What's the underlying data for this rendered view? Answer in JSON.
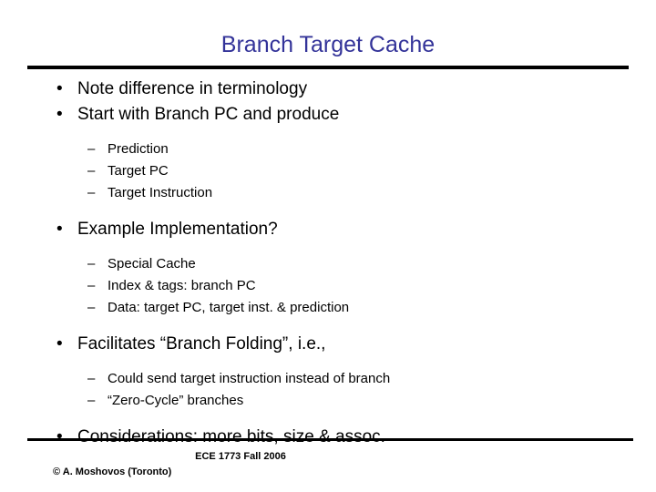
{
  "slide": {
    "title": "Branch Target Cache",
    "title_color": "#333399",
    "background_color": "#ffffff",
    "rule_color": "#000000",
    "bullet_marker": "•",
    "dash_marker": "–",
    "blocks": [
      {
        "level": 1,
        "text": "Note difference in terminology"
      },
      {
        "level": 1,
        "text": "Start with Branch PC and produce"
      },
      {
        "level": 2,
        "text": "Prediction"
      },
      {
        "level": 2,
        "text": "Target PC"
      },
      {
        "level": 2,
        "text": "Target Instruction"
      },
      {
        "level": 1,
        "text": "Example Implementation?"
      },
      {
        "level": 2,
        "text": "Special Cache"
      },
      {
        "level": 2,
        "text": "Index & tags: branch PC"
      },
      {
        "level": 2,
        "text": "Data: target PC, target inst. & prediction"
      },
      {
        "level": 1,
        "text": "Facilitates “Branch Folding”, i.e.,"
      },
      {
        "level": 2,
        "text": "Could send target instruction instead of branch"
      },
      {
        "level": 2,
        "text": "“Zero-Cycle” branches"
      },
      {
        "level": 1,
        "text": "Considerations: more bits, size & assoc."
      }
    ]
  },
  "footer": {
    "course": "ECE 1773 Fall 2006",
    "credit": "© A. Moshovos (Toronto)"
  }
}
